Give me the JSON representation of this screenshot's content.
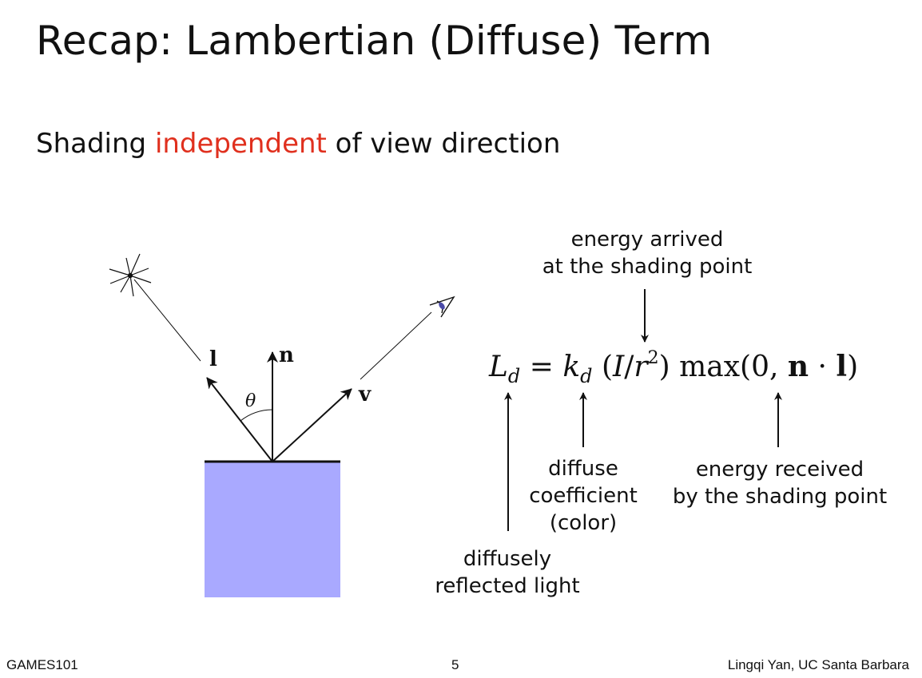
{
  "title": "Recap: Lambertian (Diffuse) Term",
  "subtitle": {
    "before": "Shading ",
    "highlight": "independent",
    "after": " of view direction",
    "highlight_color": "#e0301e"
  },
  "diagram": {
    "labels": {
      "light": "l",
      "normal": "n",
      "view": "v",
      "angle": "θ"
    },
    "surface_color": "#a9a9ff",
    "icons": [
      "light-source-icon",
      "eye-icon"
    ]
  },
  "formula": {
    "lhs_main": "L",
    "lhs_sub": "d",
    "equals": " = ",
    "k_main": "k",
    "k_sub": "d",
    "paren_open": " (",
    "I": "I",
    "slash": "/",
    "r": "r",
    "sq": "2",
    "paren_close": ") ",
    "max_open": "max(0, ",
    "n": "n",
    "dot": " · ",
    "l": "l",
    "max_close": ")"
  },
  "annotations": {
    "energy_arrived_1": "energy arrived",
    "energy_arrived_2": "at the shading point",
    "diffuse_coeff_1": "diffuse",
    "diffuse_coeff_2": "coefficient",
    "diffuse_coeff_3": "(color)",
    "energy_received_1": "energy received",
    "energy_received_2": "by the shading point",
    "diffusely_1": "diffusely",
    "diffusely_2": "reflected light"
  },
  "footer": {
    "course": "GAMES101",
    "page": "5",
    "author": "Lingqi Yan, UC Santa Barbara"
  }
}
